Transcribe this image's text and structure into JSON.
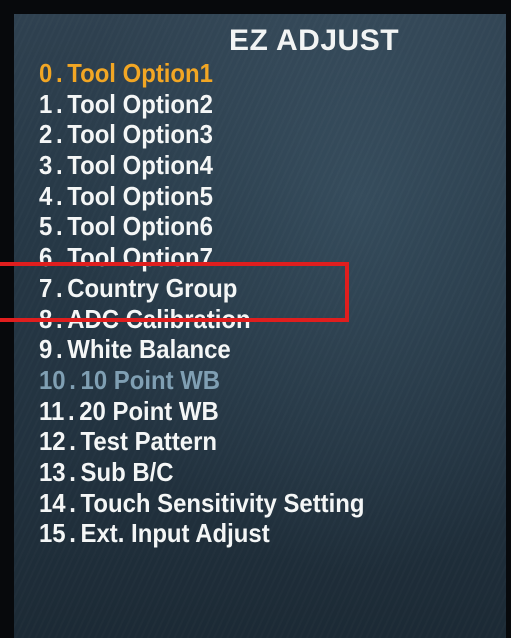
{
  "menu": {
    "title": "EZ ADJUST",
    "items": [
      {
        "num": "0",
        "label": "Tool Option1",
        "state": "selected"
      },
      {
        "num": "1",
        "label": "Tool Option2",
        "state": "normal"
      },
      {
        "num": "2",
        "label": "Tool Option3",
        "state": "normal"
      },
      {
        "num": "3",
        "label": "Tool Option4",
        "state": "normal"
      },
      {
        "num": "4",
        "label": "Tool Option5",
        "state": "normal"
      },
      {
        "num": "5",
        "label": "Tool Option6",
        "state": "normal"
      },
      {
        "num": "6",
        "label": "Tool Option7",
        "state": "normal"
      },
      {
        "num": "7",
        "label": "Country Group",
        "state": "normal"
      },
      {
        "num": "8",
        "label": "ADC Calibration",
        "state": "normal"
      },
      {
        "num": "9",
        "label": "White Balance",
        "state": "normal"
      },
      {
        "num": "10",
        "label": "10 Point WB",
        "state": "disabled"
      },
      {
        "num": "11",
        "label": "20 Point WB",
        "state": "normal"
      },
      {
        "num": "12",
        "label": "Test Pattern",
        "state": "normal"
      },
      {
        "num": "13",
        "label": "Sub B/C",
        "state": "normal"
      },
      {
        "num": "14",
        "label": "Touch Sensitivity Setting",
        "state": "normal"
      },
      {
        "num": "15",
        "label": "Ext. Input Adjust",
        "state": "normal"
      }
    ],
    "separator": "."
  },
  "colors": {
    "background": "#263846",
    "text": "#f4f6f6",
    "selected": "#f2a623",
    "disabled": "#7f9fb3",
    "annotation_box": "#e01e1e"
  }
}
